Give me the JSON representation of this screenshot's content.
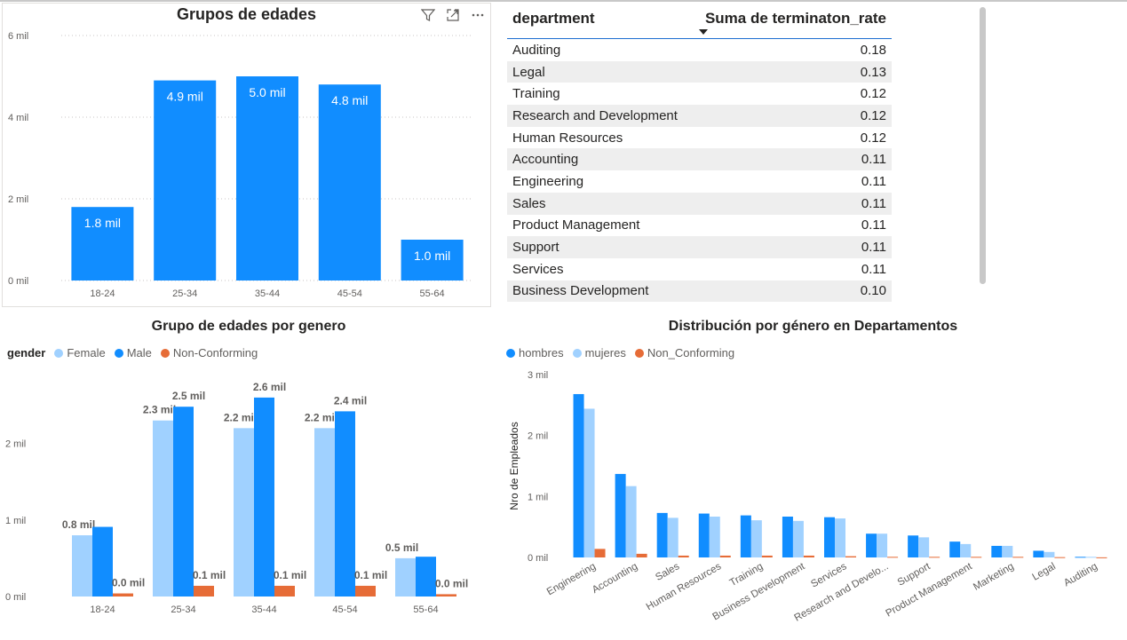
{
  "panel_age_groups": {
    "toolbar": {
      "filter_icon": "filter-icon",
      "focus_icon": "focus-mode-icon",
      "more_icon": "more-options-icon"
    },
    "chart_data": {
      "type": "bar",
      "title": "Grupos de edades",
      "categories": [
        "18-24",
        "25-34",
        "35-44",
        "45-54",
        "55-64"
      ],
      "values": [
        1800,
        4900,
        5000,
        4800,
        1000
      ],
      "data_labels": [
        "1.8 mil",
        "4.9 mil",
        "5.0 mil",
        "4.8 mil",
        "1.0 mil"
      ],
      "ylim": [
        0,
        6000
      ],
      "yticks": [
        0,
        2000,
        4000,
        6000
      ],
      "ytick_labels": [
        "0 mil",
        "2 mil",
        "4 mil",
        "6 mil"
      ],
      "grid": true,
      "color": "#118DFF"
    }
  },
  "panel_table": {
    "headers": [
      "department",
      "Suma de terminaton_rate"
    ],
    "rows": [
      [
        "Auditing",
        "0.18"
      ],
      [
        "Legal",
        "0.13"
      ],
      [
        "Training",
        "0.12"
      ],
      [
        "Research and Development",
        "0.12"
      ],
      [
        "Human Resources",
        "0.12"
      ],
      [
        "Accounting",
        "0.11"
      ],
      [
        "Engineering",
        "0.11"
      ],
      [
        "Sales",
        "0.11"
      ],
      [
        "Product Management",
        "0.11"
      ],
      [
        "Support",
        "0.11"
      ],
      [
        "Services",
        "0.11"
      ],
      [
        "Business Development",
        "0.10"
      ]
    ]
  },
  "panel_age_gender": {
    "chart_data": {
      "type": "bar",
      "title": "Grupo de edades por genero",
      "legend_title": "gender",
      "legend_position": "top-left",
      "categories": [
        "18-24",
        "25-34",
        "35-44",
        "45-54",
        "55-64"
      ],
      "series": [
        {
          "name": "Female",
          "color": "#A0D1FF",
          "values": [
            800,
            2300,
            2200,
            2200,
            500
          ],
          "labels": [
            "0.8 mil",
            "2.3 mil",
            "2.2 mil",
            "2.2 mil",
            "0.5 mil"
          ]
        },
        {
          "name": "Male",
          "color": "#118DFF",
          "values": [
            910,
            2480,
            2600,
            2420,
            520
          ],
          "labels": [
            "",
            "2.5 mil",
            "2.6 mil",
            "2.4 mil",
            ""
          ]
        },
        {
          "name": "Non-Conforming",
          "color": "#E66C37",
          "values": [
            40,
            140,
            140,
            140,
            30
          ],
          "labels": [
            "0.0 mil",
            "0.1 mil",
            "0.1 mil",
            "0.1 mil",
            "0.0 mil"
          ]
        }
      ],
      "ylim": [
        0,
        2900
      ],
      "yticks": [
        0,
        1000,
        2000
      ],
      "ytick_labels": [
        "0 mil",
        "1 mil",
        "2 mil"
      ]
    }
  },
  "panel_dept_gender": {
    "chart_data": {
      "type": "bar",
      "title": "Distribución por género en Departamentos",
      "ylabel": "Nro de Empleados",
      "legend_position": "top-left",
      "categories": [
        "Engineering",
        "Accounting",
        "Sales",
        "Human Resources",
        "Training",
        "Business Development",
        "Services",
        "Research and Develo...",
        "Support",
        "Product Management",
        "Marketing",
        "Legal",
        "Auditing"
      ],
      "series": [
        {
          "name": "hombres",
          "color": "#118DFF",
          "values": [
            2680,
            1370,
            730,
            720,
            690,
            670,
            660,
            390,
            360,
            260,
            190,
            110,
            10
          ]
        },
        {
          "name": "mujeres",
          "color": "#A0D1FF",
          "values": [
            2440,
            1170,
            650,
            670,
            610,
            600,
            640,
            390,
            330,
            220,
            190,
            90,
            10
          ]
        },
        {
          "name": "Non_Conforming",
          "color": "#E66C37",
          "values": [
            140,
            60,
            30,
            30,
            30,
            30,
            20,
            10,
            10,
            10,
            10,
            5,
            2
          ]
        }
      ],
      "ylim": [
        0,
        3000
      ],
      "yticks": [
        0,
        1000,
        2000,
        3000
      ],
      "ytick_labels": [
        "0 mil",
        "1 mil",
        "2 mil",
        "3 mil"
      ]
    }
  }
}
